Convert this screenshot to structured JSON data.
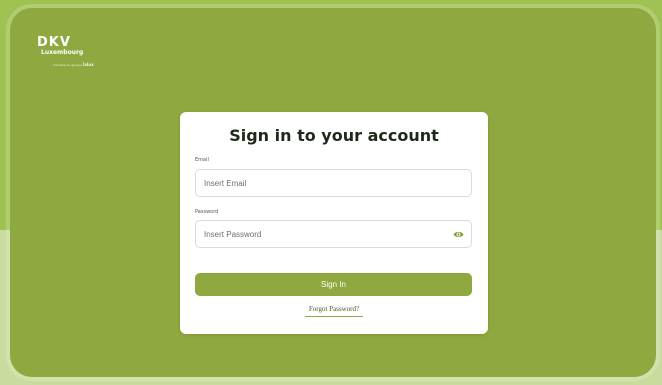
{
  "brand": {
    "name": "DKV",
    "region": "Luxembourg",
    "tagline_prefix": "membre du groupe",
    "tagline_brand": "lalux"
  },
  "login": {
    "title": "Sign in to your account",
    "email_label": "Email",
    "email_placeholder": "Insert Email",
    "password_label": "Password",
    "password_placeholder": "Insert Password",
    "submit_label": "Sign In",
    "forgot_label": "Forgot Password?"
  },
  "icons": {
    "password_toggle": "eye-icon"
  },
  "colors": {
    "brand_green": "#8fa83f",
    "light_green": "#9fc253",
    "title_text": "#1d2a19"
  }
}
